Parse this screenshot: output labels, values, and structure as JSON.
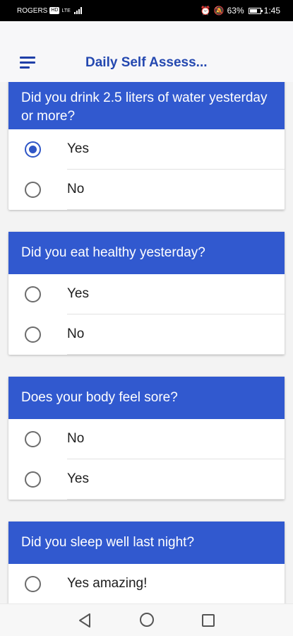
{
  "status_bar": {
    "carrier": "ROGERS",
    "network_badge": "HD",
    "network_type": "LTE",
    "battery": "63%",
    "time": "1:45"
  },
  "app_bar": {
    "title": "Daily Self Assess..."
  },
  "questions": [
    {
      "question": "Did you drink 2.5 liters of water yesterday or more?",
      "options": [
        {
          "label": "Yes",
          "selected": true
        },
        {
          "label": "No",
          "selected": false
        }
      ]
    },
    {
      "question": "Did you eat healthy yesterday?",
      "options": [
        {
          "label": "Yes",
          "selected": false
        },
        {
          "label": "No",
          "selected": false
        }
      ]
    },
    {
      "question": "Does your body feel sore?",
      "options": [
        {
          "label": "No",
          "selected": false
        },
        {
          "label": "Yes",
          "selected": false
        }
      ]
    },
    {
      "question": "Did you sleep well last night?",
      "options": [
        {
          "label": "Yes amazing!",
          "selected": false
        }
      ]
    }
  ],
  "colors": {
    "accent": "#3159cf",
    "title": "#2448b0"
  },
  "nav_icons": [
    "back-triangle-icon",
    "home-circle-icon",
    "recent-square-icon"
  ]
}
